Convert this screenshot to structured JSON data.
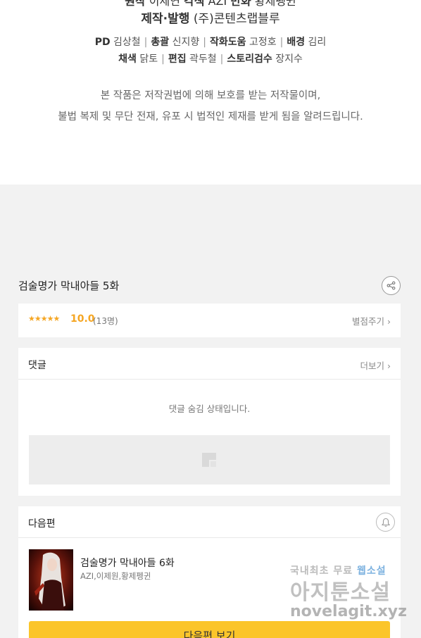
{
  "credits": {
    "cut_line_a": "원작",
    "cut_line_b": " 이세연 ",
    "cut_line_c": "각색",
    "cut_line_d": " AZI ",
    "cut_line_e": "만화",
    "cut_line_f": " 황제펭귄",
    "producer_label": "제작·발행",
    "producer_value": " (주)콘텐츠랩블루",
    "staff_line1": [
      {
        "role": "PD",
        "name": "김상철"
      },
      {
        "role": "총괄",
        "name": "신지향"
      },
      {
        "role": "작화도움",
        "name": "고정호"
      },
      {
        "role": "배경",
        "name": "김리"
      }
    ],
    "staff_line2": [
      {
        "role": "채색",
        "name": "닭토"
      },
      {
        "role": "편집",
        "name": "곽두철"
      },
      {
        "role": "스토리검수",
        "name": "장지수"
      }
    ],
    "separator": "|",
    "notice_line1": "본 작품은 저작권법에 의해 보호를 받는 저작물이며,",
    "notice_line2": "불법 복제 및 무단 전재, 유포 시 법적인 제재를 받게 됨을 알려드립니다."
  },
  "episode": {
    "title": "검술명가 막내아들 5화",
    "share_icon": "share-icon"
  },
  "rating": {
    "stars": "★★★★★",
    "score": "10.0",
    "count": "(13명)",
    "rate_link": "별점주기",
    "chevron": "›"
  },
  "comments": {
    "title": "댓글",
    "more_link": "더보기",
    "chevron": "›",
    "hidden_message": "댓글 숨김 상태입니다."
  },
  "next_episode": {
    "section_title": "다음편",
    "title": "검술명가 막내아들 6화",
    "authors": "AZI,이제원,황제펭귄",
    "button_label": "다음편 보기",
    "bell_icon": "bell-icon"
  },
  "watermark": {
    "line1_a": "국내최초 무료 ",
    "line1_b": "웹소설",
    "line2": "아지툰소설",
    "line3": "novelagit.xyz"
  },
  "colors": {
    "accent_star": "#f5a623",
    "button_yellow": "#fbc52a",
    "background": "#f2f2f2"
  }
}
